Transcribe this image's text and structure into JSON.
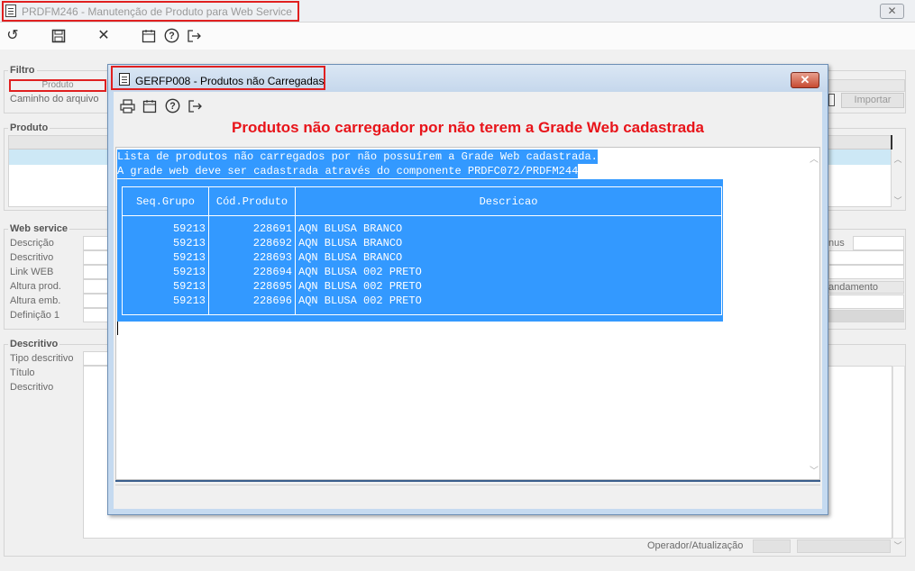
{
  "main_window": {
    "title": "PRDFM246 - Manutenção de Produto para Web Service",
    "close_label": "✕",
    "toolbar": [
      "undo-icon",
      "save-icon",
      "cancel-icon",
      "calendar-icon",
      "help-icon",
      "exit-icon"
    ],
    "filtro": {
      "label": "Filtro",
      "produto_tab": "Produto",
      "caminho_label": "Caminho do arquivo",
      "importar_label": "Importar"
    },
    "produto_group": {
      "label": "Produto"
    },
    "webservice": {
      "label": "Web service",
      "fields": [
        "Descrição",
        "Descritivo",
        "Link WEB",
        "Altura prod.",
        "Altura emb.",
        "Definição 1"
      ],
      "right_labels": [
        "nus",
        "andamento"
      ]
    },
    "descritivo": {
      "label": "Descritivo",
      "fields": [
        "Tipo descritivo",
        "Título",
        "Descritivo"
      ]
    },
    "operador_label": "Operador/Atualização"
  },
  "dialog": {
    "title": "GERFP008 - Produtos não Carregadas",
    "close_label": "✕",
    "toolbar": [
      "print-icon",
      "calendar-icon",
      "help-icon",
      "exit-icon"
    ],
    "heading": "Produtos não carregador por não terem a Grade Web cadastrada",
    "line1": "Lista de produtos não carregados por não possuírem a Grade Web cadastrada.",
    "line2": "A grade web deve ser cadastrada através do componente PRDFC072/PRDFM244",
    "table": {
      "headers": [
        "Seq.Grupo",
        "Cód.Produto",
        "Descricao"
      ],
      "rows": [
        [
          "59213",
          "228691",
          "AQN BLUSA BRANCO"
        ],
        [
          "59213",
          "228692",
          "AQN BLUSA BRANCO"
        ],
        [
          "59213",
          "228693",
          "AQN BLUSA BRANCO"
        ],
        [
          "59213",
          "228694",
          "AQN BLUSA 002 PRETO"
        ],
        [
          "59213",
          "228695",
          "AQN BLUSA 002 PRETO"
        ],
        [
          "59213",
          "228696",
          "AQN BLUSA 002 PRETO"
        ]
      ]
    }
  },
  "colors": {
    "selection": "#3399ff",
    "heading_red": "#e8141a",
    "highlight_box": "#e02020"
  }
}
